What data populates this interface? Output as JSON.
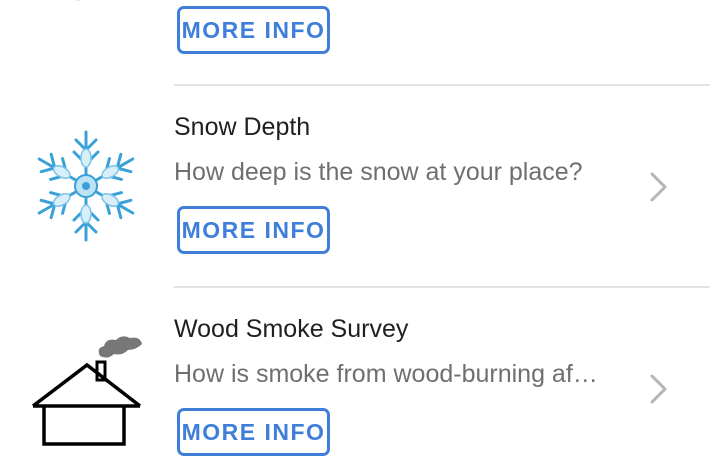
{
  "list": {
    "items": [
      {
        "title": "",
        "description": "",
        "button_label": "MORE INFO",
        "icon": "water-icon"
      },
      {
        "title": "Snow Depth",
        "description": "How deep is the snow at your place?",
        "button_label": "MORE INFO",
        "icon": "snowflake-icon"
      },
      {
        "title": "Wood Smoke Survey",
        "description": "How is smoke from wood-burning af…",
        "button_label": "MORE INFO",
        "icon": "house-smoke-icon"
      }
    ]
  },
  "colors": {
    "accent": "#3f7fd9",
    "divider": "#e2e2e2",
    "title": "#1f1f1f",
    "description": "#6f6f6f"
  }
}
